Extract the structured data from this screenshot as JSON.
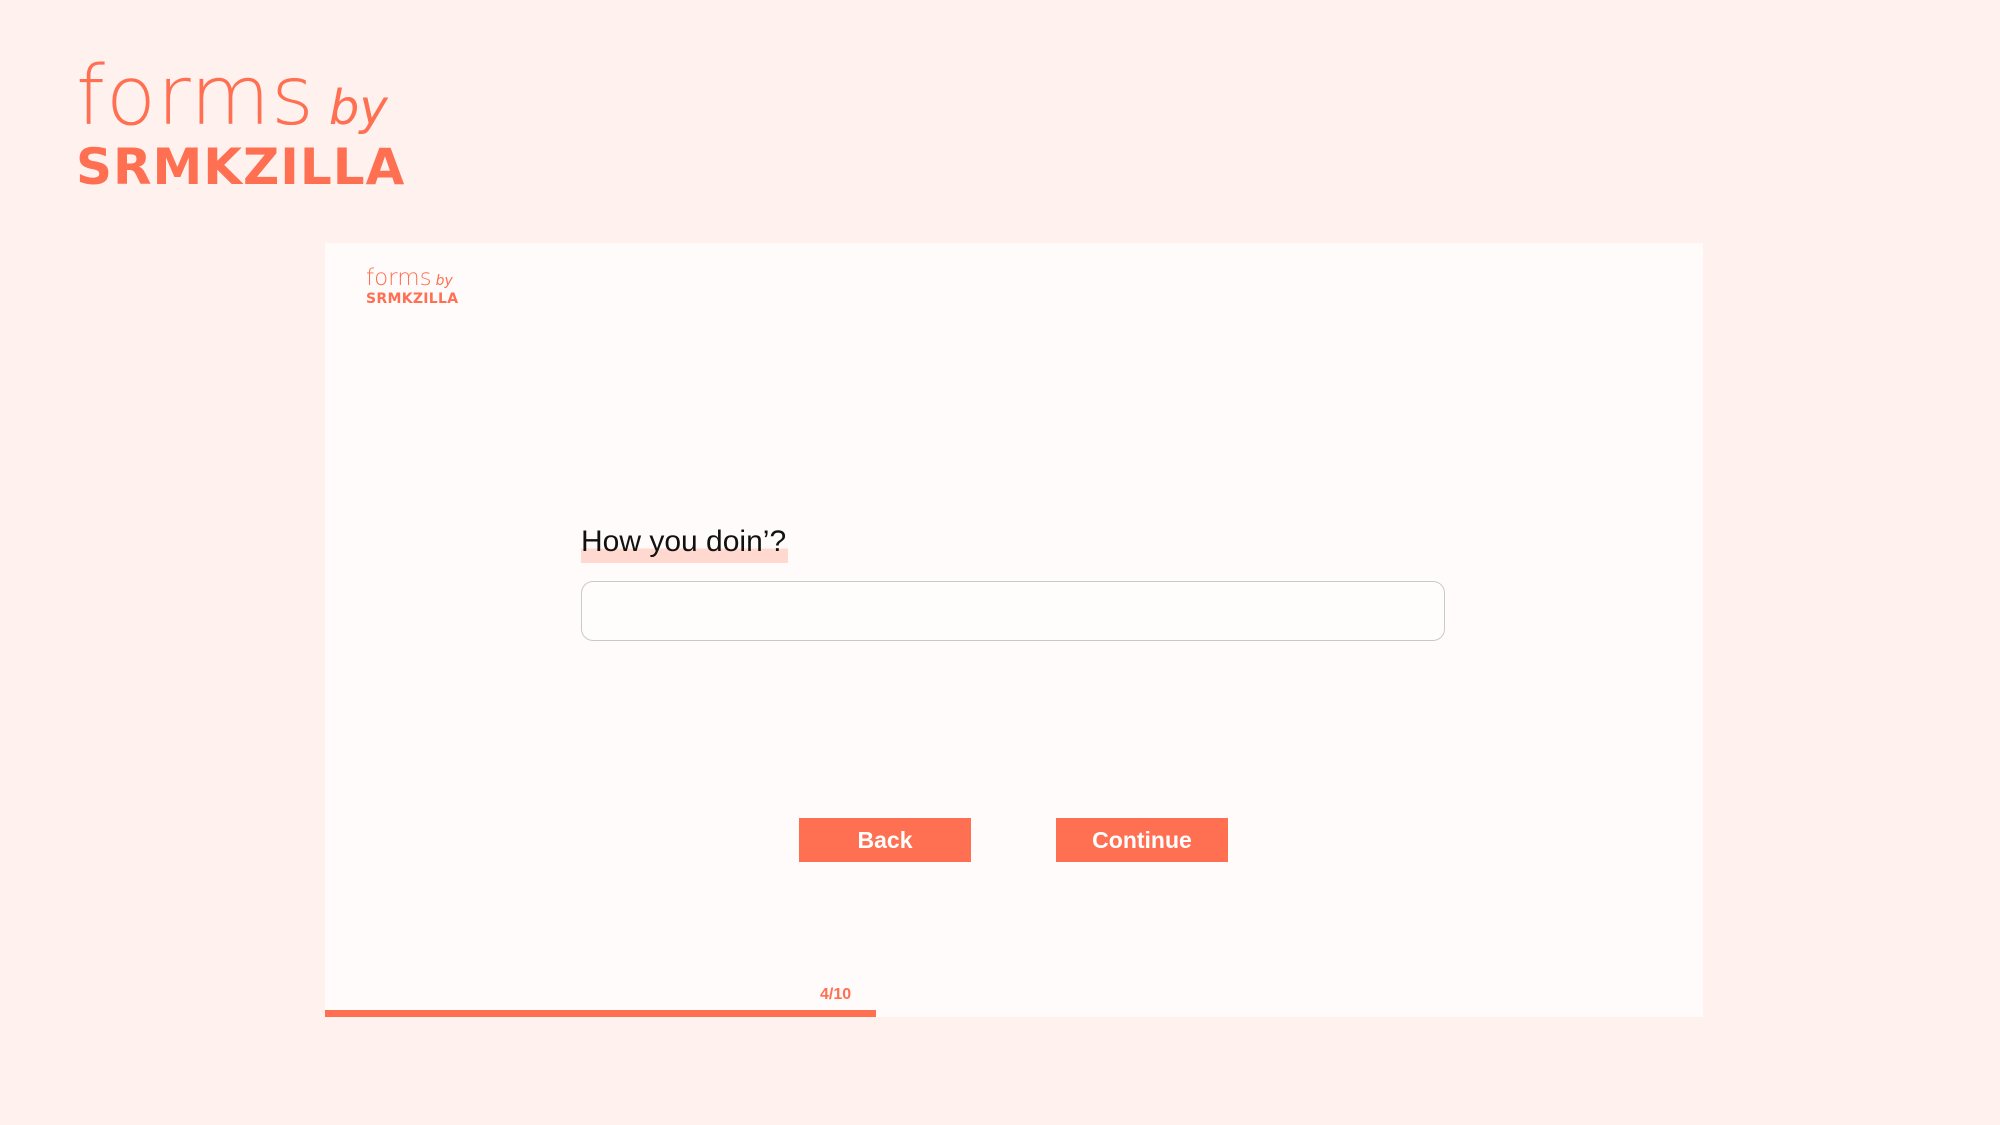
{
  "brand": {
    "forms": "forms",
    "by": "by",
    "org": "SRMKZILLA"
  },
  "form": {
    "question": "How you doin’?",
    "answer_value": "",
    "answer_placeholder": "",
    "back_label": "Back",
    "continue_label": "Continue",
    "progress_text": "4/10",
    "progress_current": 4,
    "progress_total": 10
  },
  "colors": {
    "accent": "#ff6f52",
    "background": "#fff2ee",
    "card": "#fffbfa"
  }
}
